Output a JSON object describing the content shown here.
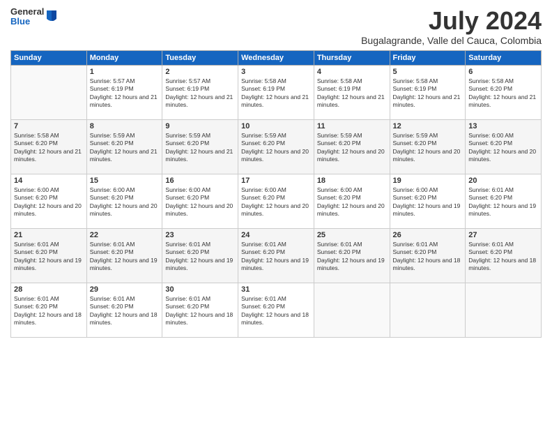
{
  "header": {
    "logo": {
      "line1": "General",
      "line2": "Blue"
    },
    "title": "July 2024",
    "location": "Bugalagrande, Valle del Cauca, Colombia"
  },
  "days_of_week": [
    "Sunday",
    "Monday",
    "Tuesday",
    "Wednesday",
    "Thursday",
    "Friday",
    "Saturday"
  ],
  "weeks": [
    [
      {
        "day": "",
        "info": ""
      },
      {
        "day": "1",
        "info": "Sunrise: 5:57 AM\nSunset: 6:19 PM\nDaylight: 12 hours and 21 minutes."
      },
      {
        "day": "2",
        "info": "Sunrise: 5:57 AM\nSunset: 6:19 PM\nDaylight: 12 hours and 21 minutes."
      },
      {
        "day": "3",
        "info": "Sunrise: 5:58 AM\nSunset: 6:19 PM\nDaylight: 12 hours and 21 minutes."
      },
      {
        "day": "4",
        "info": "Sunrise: 5:58 AM\nSunset: 6:19 PM\nDaylight: 12 hours and 21 minutes."
      },
      {
        "day": "5",
        "info": "Sunrise: 5:58 AM\nSunset: 6:19 PM\nDaylight: 12 hours and 21 minutes."
      },
      {
        "day": "6",
        "info": "Sunrise: 5:58 AM\nSunset: 6:20 PM\nDaylight: 12 hours and 21 minutes."
      }
    ],
    [
      {
        "day": "7",
        "info": "Sunrise: 5:58 AM\nSunset: 6:20 PM\nDaylight: 12 hours and 21 minutes."
      },
      {
        "day": "8",
        "info": "Sunrise: 5:59 AM\nSunset: 6:20 PM\nDaylight: 12 hours and 21 minutes."
      },
      {
        "day": "9",
        "info": "Sunrise: 5:59 AM\nSunset: 6:20 PM\nDaylight: 12 hours and 21 minutes."
      },
      {
        "day": "10",
        "info": "Sunrise: 5:59 AM\nSunset: 6:20 PM\nDaylight: 12 hours and 20 minutes."
      },
      {
        "day": "11",
        "info": "Sunrise: 5:59 AM\nSunset: 6:20 PM\nDaylight: 12 hours and 20 minutes."
      },
      {
        "day": "12",
        "info": "Sunrise: 5:59 AM\nSunset: 6:20 PM\nDaylight: 12 hours and 20 minutes."
      },
      {
        "day": "13",
        "info": "Sunrise: 6:00 AM\nSunset: 6:20 PM\nDaylight: 12 hours and 20 minutes."
      }
    ],
    [
      {
        "day": "14",
        "info": "Sunrise: 6:00 AM\nSunset: 6:20 PM\nDaylight: 12 hours and 20 minutes."
      },
      {
        "day": "15",
        "info": "Sunrise: 6:00 AM\nSunset: 6:20 PM\nDaylight: 12 hours and 20 minutes."
      },
      {
        "day": "16",
        "info": "Sunrise: 6:00 AM\nSunset: 6:20 PM\nDaylight: 12 hours and 20 minutes."
      },
      {
        "day": "17",
        "info": "Sunrise: 6:00 AM\nSunset: 6:20 PM\nDaylight: 12 hours and 20 minutes."
      },
      {
        "day": "18",
        "info": "Sunrise: 6:00 AM\nSunset: 6:20 PM\nDaylight: 12 hours and 20 minutes."
      },
      {
        "day": "19",
        "info": "Sunrise: 6:00 AM\nSunset: 6:20 PM\nDaylight: 12 hours and 19 minutes."
      },
      {
        "day": "20",
        "info": "Sunrise: 6:01 AM\nSunset: 6:20 PM\nDaylight: 12 hours and 19 minutes."
      }
    ],
    [
      {
        "day": "21",
        "info": "Sunrise: 6:01 AM\nSunset: 6:20 PM\nDaylight: 12 hours and 19 minutes."
      },
      {
        "day": "22",
        "info": "Sunrise: 6:01 AM\nSunset: 6:20 PM\nDaylight: 12 hours and 19 minutes."
      },
      {
        "day": "23",
        "info": "Sunrise: 6:01 AM\nSunset: 6:20 PM\nDaylight: 12 hours and 19 minutes."
      },
      {
        "day": "24",
        "info": "Sunrise: 6:01 AM\nSunset: 6:20 PM\nDaylight: 12 hours and 19 minutes."
      },
      {
        "day": "25",
        "info": "Sunrise: 6:01 AM\nSunset: 6:20 PM\nDaylight: 12 hours and 19 minutes."
      },
      {
        "day": "26",
        "info": "Sunrise: 6:01 AM\nSunset: 6:20 PM\nDaylight: 12 hours and 18 minutes."
      },
      {
        "day": "27",
        "info": "Sunrise: 6:01 AM\nSunset: 6:20 PM\nDaylight: 12 hours and 18 minutes."
      }
    ],
    [
      {
        "day": "28",
        "info": "Sunrise: 6:01 AM\nSunset: 6:20 PM\nDaylight: 12 hours and 18 minutes."
      },
      {
        "day": "29",
        "info": "Sunrise: 6:01 AM\nSunset: 6:20 PM\nDaylight: 12 hours and 18 minutes."
      },
      {
        "day": "30",
        "info": "Sunrise: 6:01 AM\nSunset: 6:20 PM\nDaylight: 12 hours and 18 minutes."
      },
      {
        "day": "31",
        "info": "Sunrise: 6:01 AM\nSunset: 6:20 PM\nDaylight: 12 hours and 18 minutes."
      },
      {
        "day": "",
        "info": ""
      },
      {
        "day": "",
        "info": ""
      },
      {
        "day": "",
        "info": ""
      }
    ]
  ]
}
